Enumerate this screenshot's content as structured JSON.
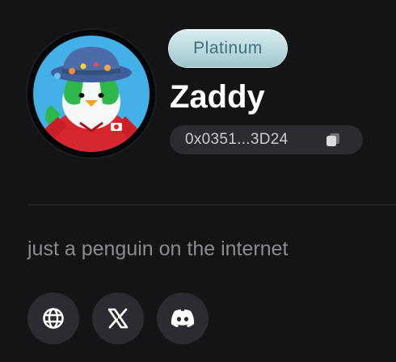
{
  "profile": {
    "tier_badge": "Platinum",
    "username": "Zaddy",
    "wallet_address": "0x0351...3D24",
    "bio": "just a penguin on the internet"
  },
  "icons": {
    "avatar": "penguin-bucket-hat-avatar",
    "copy": "copy-icon",
    "social": [
      "globe-icon",
      "x-logo-icon",
      "discord-logo-icon"
    ]
  },
  "colors": {
    "background": "#141416",
    "badge": "#b9d9de",
    "badge_text": "#3f6f7a",
    "pill": "#2a2c31",
    "username": "#ffffff",
    "bio": "#8a8c92"
  }
}
